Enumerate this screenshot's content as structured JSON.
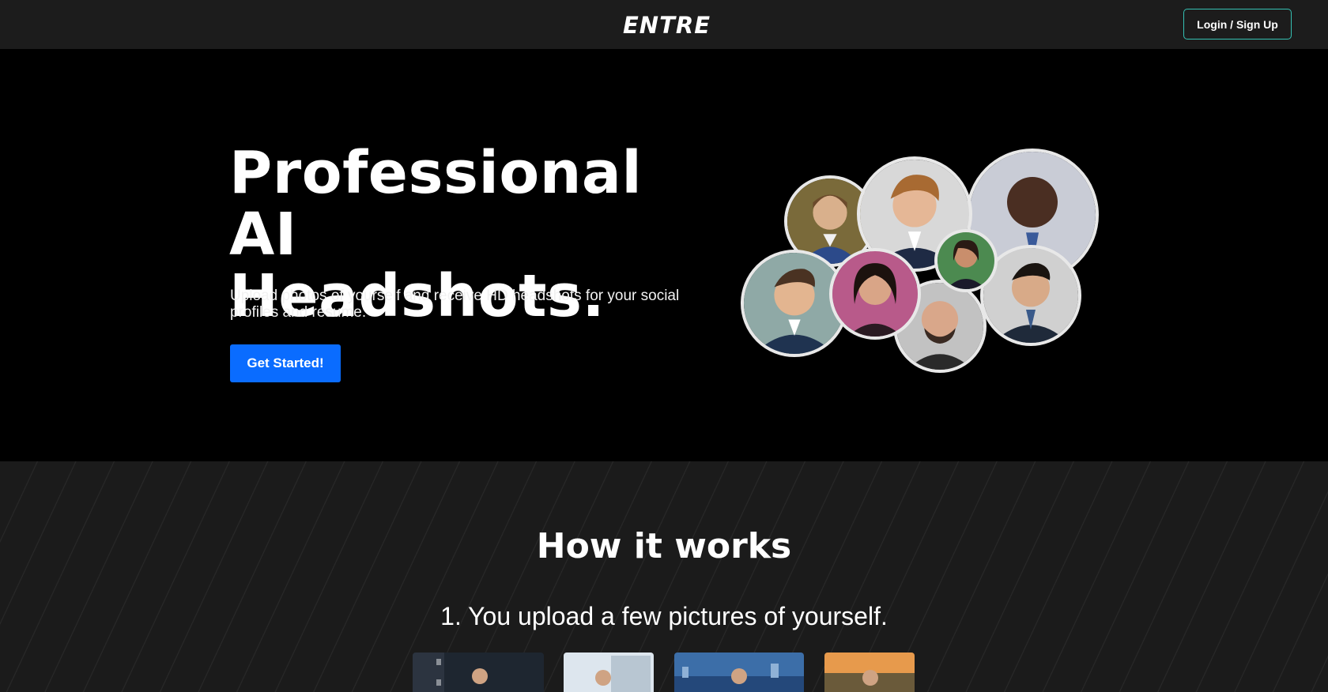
{
  "nav": {
    "logo": "ENTRE",
    "login_label": "Login / Sign Up"
  },
  "hero": {
    "title": "Professional AI Headshots.",
    "subtitle": "Upload photos of yourself and receive HD headshots for your social profiles and resume.",
    "cta_label": "Get Started!"
  },
  "how": {
    "title": "How it works",
    "step1": "1. You upload a few pictures of yourself."
  },
  "colors": {
    "nav_bg": "#1c1c1c",
    "hero_bg": "#000000",
    "accent_button": "#0a6cff",
    "login_border": "#35c0b3",
    "section_bg": "#1b1b1b"
  }
}
